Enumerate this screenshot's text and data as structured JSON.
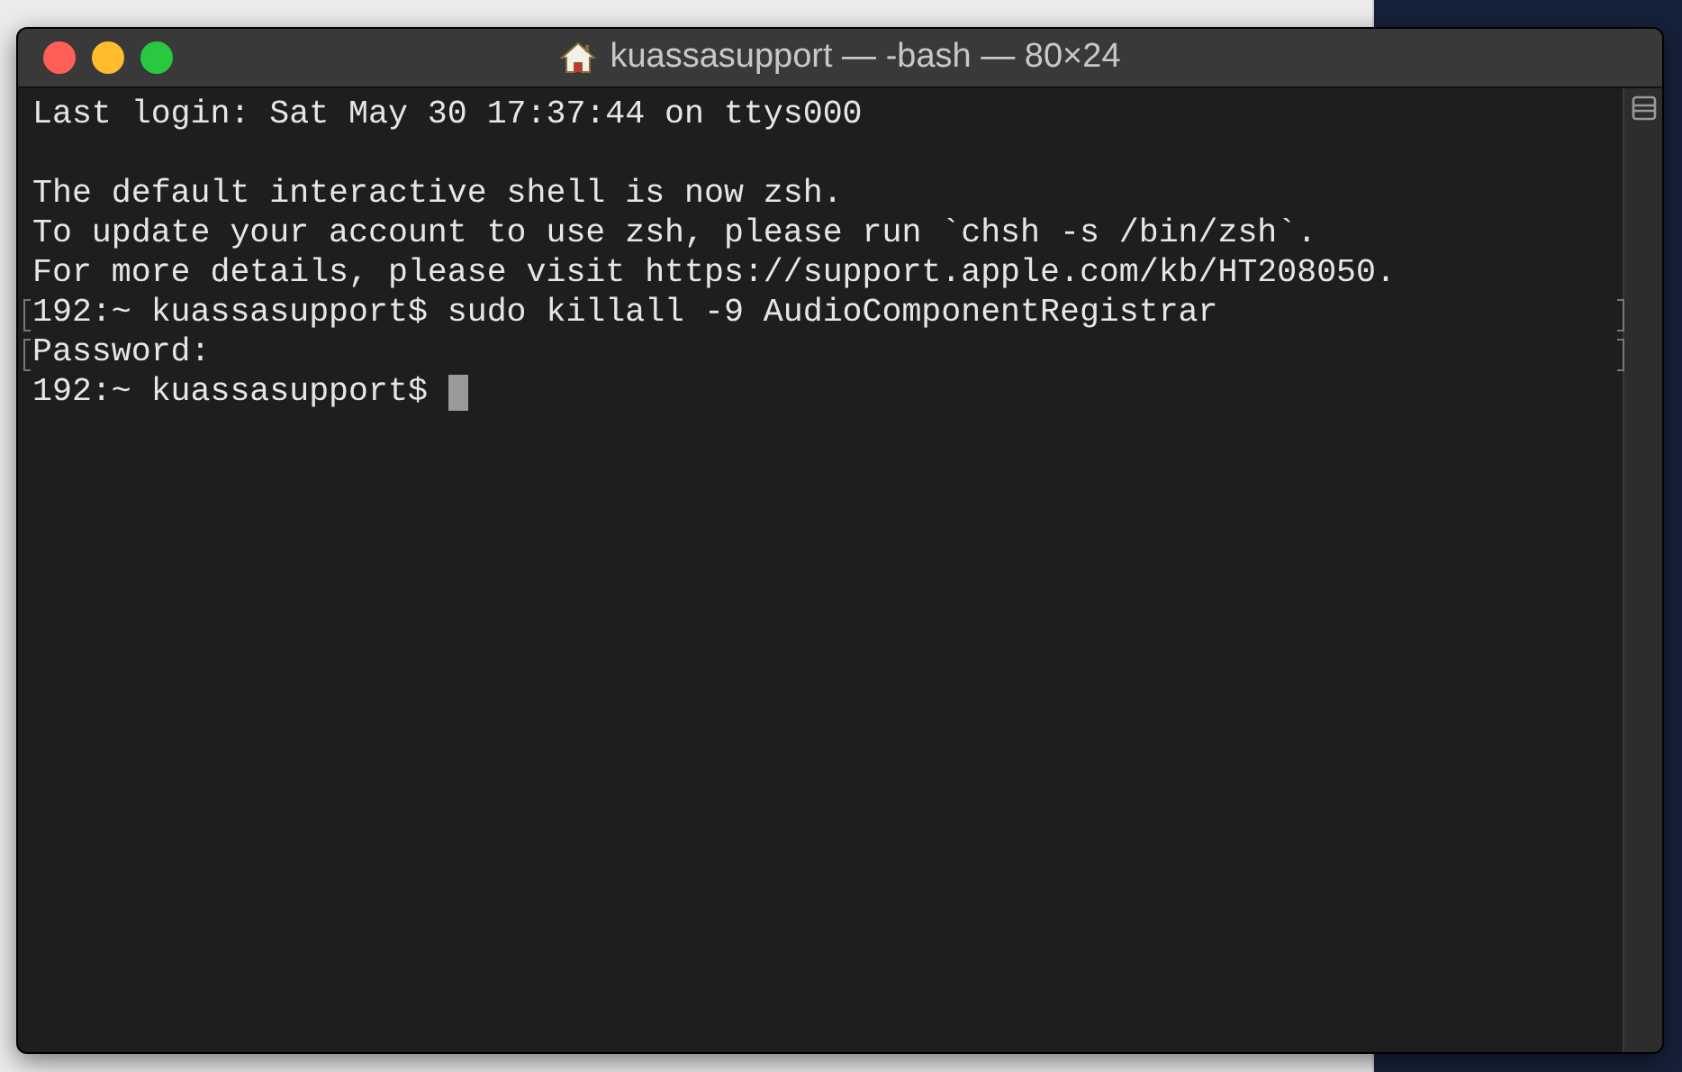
{
  "window": {
    "title": "kuassasupport — -bash — 80×24"
  },
  "terminal": {
    "lines": [
      {
        "text": "Last login: Sat May 30 17:37:44 on ttys000",
        "bookmarked": false,
        "cursor": false
      },
      {
        "bookmarked": false,
        "cursor": false
      },
      {
        "text": "The default interactive shell is now zsh.",
        "bookmarked": false,
        "cursor": false
      },
      {
        "text": "To update your account to use zsh, please run `chsh -s /bin/zsh`.",
        "bookmarked": false,
        "cursor": false
      },
      {
        "text": "For more details, please visit https://support.apple.com/kb/HT208050.",
        "bookmarked": false,
        "cursor": false
      },
      {
        "text": "192:~ kuassasupport$ sudo killall -9 AudioComponentRegistrar",
        "bookmarked": true,
        "cursor": false
      },
      {
        "text": "Password:",
        "bookmarked": true,
        "cursor": false
      },
      {
        "text": "192:~ kuassasupport$ ",
        "bookmarked": false,
        "cursor": true
      }
    ]
  }
}
